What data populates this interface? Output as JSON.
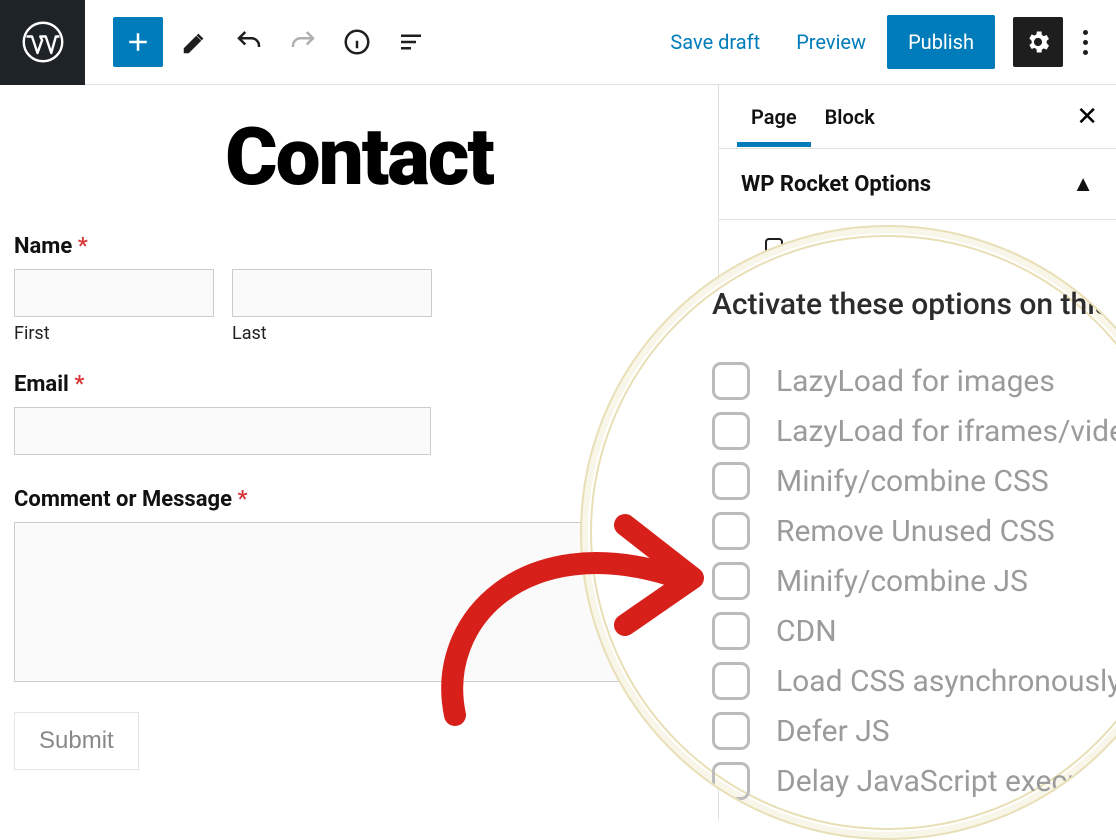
{
  "toolbar": {
    "save_draft": "Save draft",
    "preview": "Preview",
    "publish": "Publish"
  },
  "page": {
    "title": "Contact"
  },
  "form": {
    "name_label": "Name",
    "first_label": "First",
    "last_label": "Last",
    "email_label": "Email",
    "message_label": "Comment or Message",
    "submit_label": "Submit",
    "required_marker": "*"
  },
  "sidebar": {
    "tabs": {
      "page": "Page",
      "block": "Block"
    },
    "panel_title": "WP Rocket Options"
  },
  "zoom": {
    "heading": "Activate these options on this post:",
    "options": [
      "LazyLoad for images",
      "LazyLoad for iframes/videos",
      "Minify/combine CSS",
      "Remove Unused CSS",
      "Minify/combine JS",
      "CDN",
      "Load CSS asynchronously",
      "Defer JS",
      "Delay JavaScript execution"
    ]
  }
}
